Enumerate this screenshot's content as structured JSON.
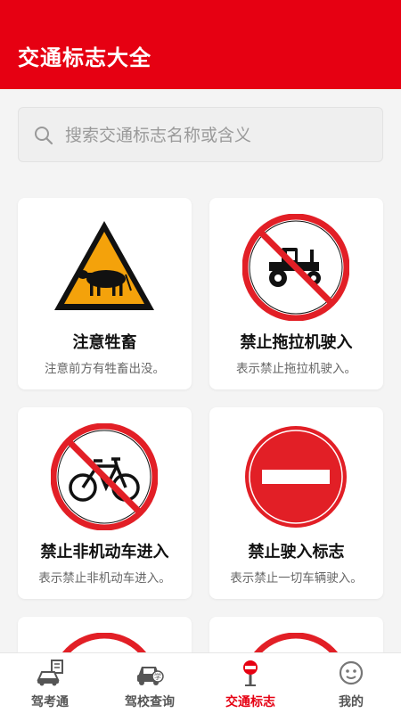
{
  "header": {
    "title": "交通标志大全"
  },
  "search": {
    "placeholder": "搜索交通标志名称或含义",
    "icon": "search-icon"
  },
  "signs": [
    {
      "name": "注意牲畜",
      "desc": "注意前方有牲畜出没。",
      "icon": "livestock-warning-icon"
    },
    {
      "name": "禁止拖拉机驶入",
      "desc": "表示禁止拖拉机驶入。",
      "icon": "no-tractor-icon"
    },
    {
      "name": "禁止非机动车进入",
      "desc": "表示禁止非机动车进入。",
      "icon": "no-bicycle-icon"
    },
    {
      "name": "禁止驶入标志",
      "desc": "表示禁止一切车辆驶入。",
      "icon": "no-entry-icon"
    }
  ],
  "tabs": [
    {
      "label": "驾考通",
      "icon": "car-exam-icon"
    },
    {
      "label": "驾校查询",
      "icon": "school-car-icon"
    },
    {
      "label": "交通标志",
      "icon": "traffic-sign-icon"
    },
    {
      "label": "我的",
      "icon": "profile-face-icon"
    }
  ],
  "colors": {
    "brand": "#e60012",
    "warning_yellow": "#f4a20b",
    "prohibition_red": "#e21f26"
  }
}
